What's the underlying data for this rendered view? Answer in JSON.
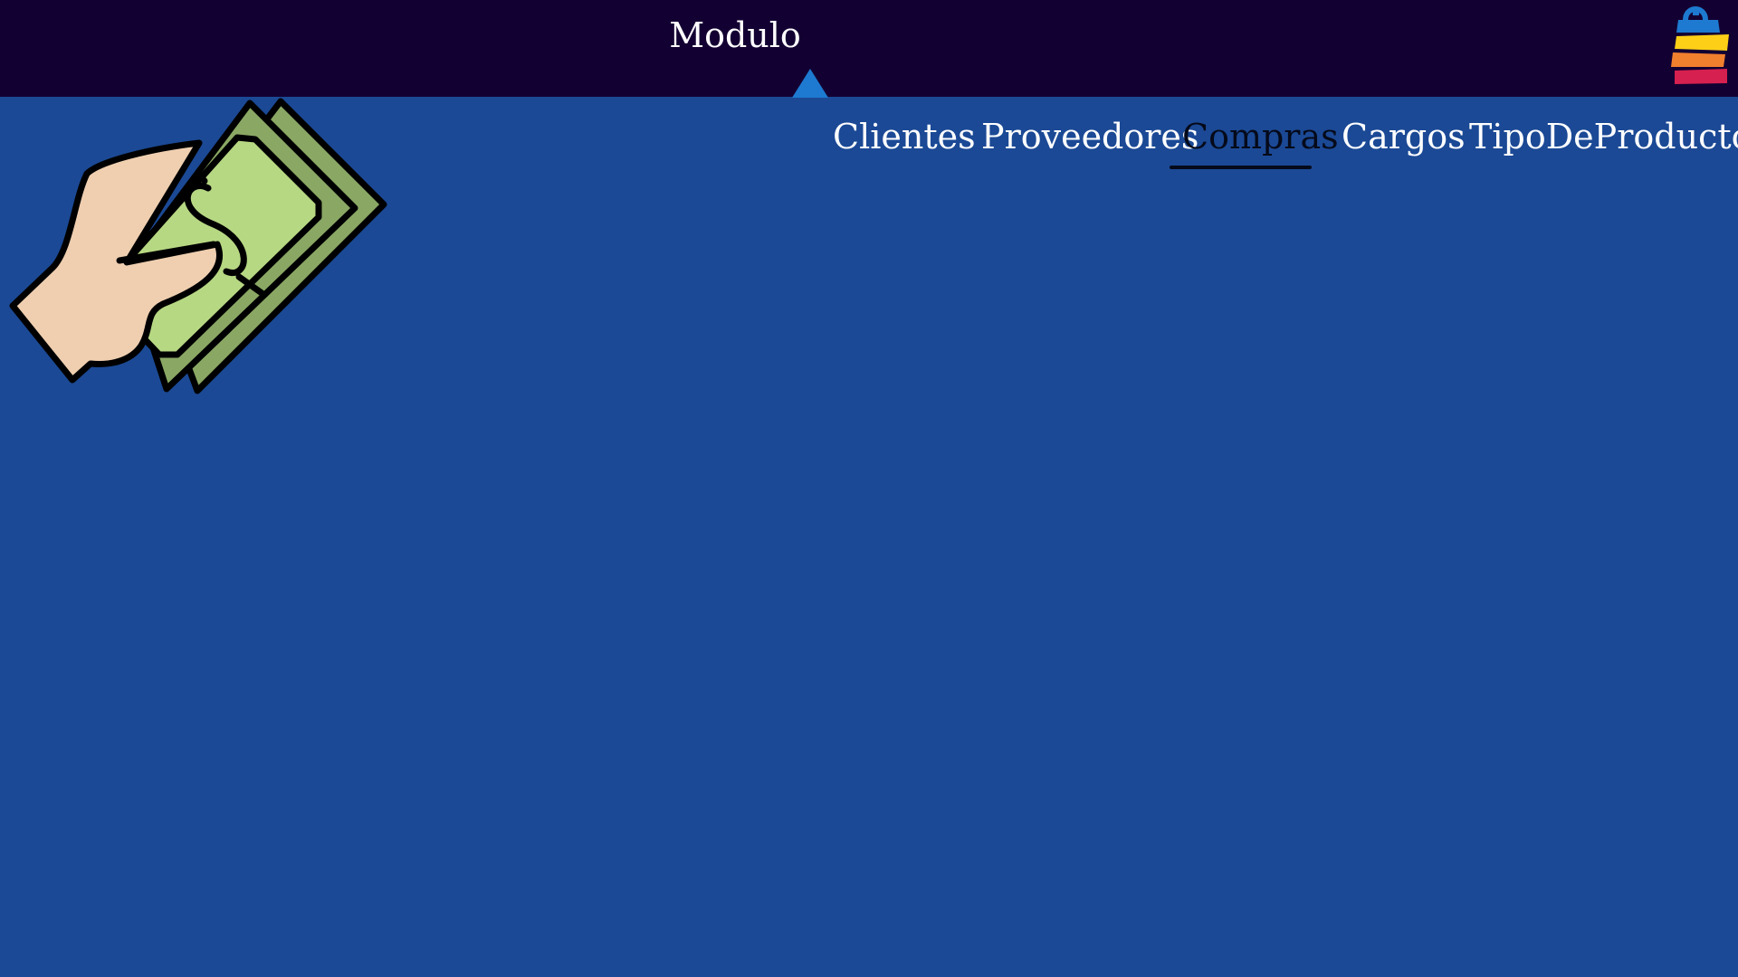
{
  "header": {
    "module_label": "Modulo"
  },
  "tabs": [
    {
      "label": "Clientes",
      "active": false
    },
    {
      "label": "Proveedores",
      "active": false
    },
    {
      "label": "Compras",
      "active": true
    },
    {
      "label": "Cargos",
      "active": false
    },
    {
      "label": "TipoDeProducto",
      "active": false
    }
  ],
  "icons": {
    "logo": "shopping-bag-icon",
    "illustration": "hand-holding-money-icon"
  },
  "colors": {
    "background": "#1b4995",
    "topbar": "#130032",
    "caret": "#1d7ad0",
    "active_tab": "#050a1a",
    "inactive_tab": "#ffffff"
  }
}
